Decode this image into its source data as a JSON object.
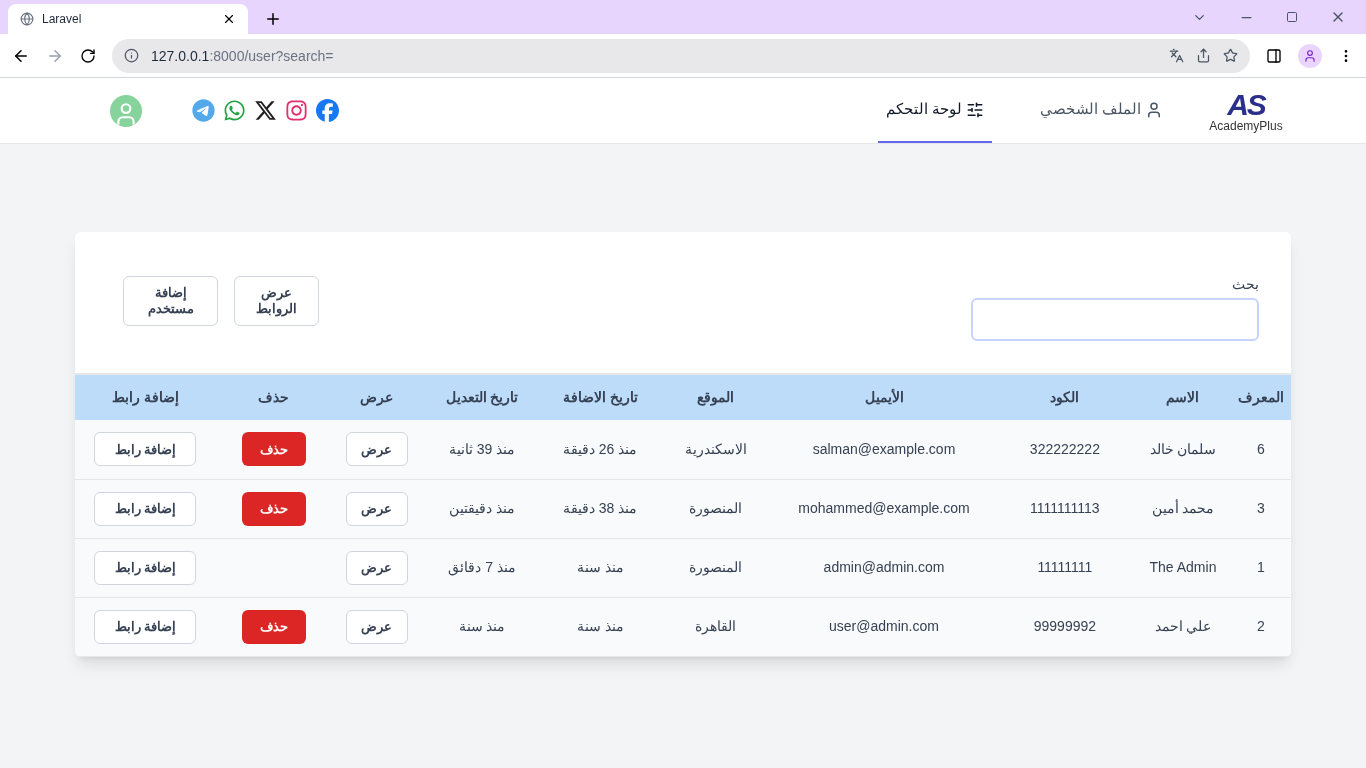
{
  "browser": {
    "tab_title": "Laravel",
    "url_host": "127.0.0.1",
    "url_rest": ":8000/user?search="
  },
  "header": {
    "logo": {
      "mark": "AS",
      "name": "AcademyPlus"
    },
    "nav": [
      {
        "label": "الملف الشخصي",
        "selected": false
      },
      {
        "label": "لوحة التحكم",
        "selected": true
      }
    ]
  },
  "search": {
    "label": "بحث"
  },
  "buttons": [
    {
      "label": "عرض الروابط"
    },
    {
      "label": "إضافة مستخدم"
    }
  ],
  "table": {
    "columns": [
      "المعرف",
      "الاسم",
      "الكود",
      "الأيميل",
      "الموقع",
      "تاريخ الاضافة",
      "تاريخ التعديل",
      "عرض",
      "حذف",
      "إضافة رابط"
    ],
    "rows": [
      {
        "id": "6",
        "name": "سلمان خالد",
        "code": "322222222",
        "email": "salman@example.com",
        "location": "الاسكندرية",
        "created": "منذ 26 دقيقة",
        "updated": "منذ 39 ثانية",
        "view": "عرض",
        "delete": "حذف",
        "add_link": "إضافة رابط"
      },
      {
        "id": "3",
        "name": "محمد أمين",
        "code": "1111111113",
        "email": "mohammed@example.com",
        "location": "المنصورة",
        "created": "منذ 38 دقيقة",
        "updated": "منذ دقيقتين",
        "view": "عرض",
        "delete": "حذف",
        "add_link": "إضافة رابط"
      },
      {
        "id": "1",
        "name": "The Admin",
        "code": "11111111",
        "email": "admin@admin.com",
        "location": "المنصورة",
        "created": "منذ سنة",
        "updated": "منذ 7 دقائق",
        "view": "عرض",
        "add_link": "إضافة رابط"
      },
      {
        "id": "2",
        "name": "علي احمد",
        "code": "99999992",
        "email": "user@admin.com",
        "location": "القاهرة",
        "created": "منذ سنة",
        "updated": "منذ سنة",
        "view": "عرض",
        "delete": "حذف",
        "add_link": "إضافة رابط"
      }
    ]
  }
}
